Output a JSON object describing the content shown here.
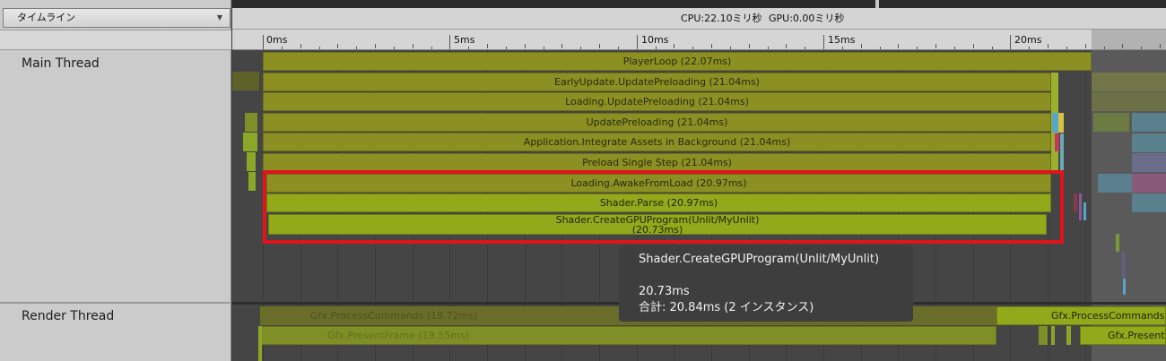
{
  "header": {
    "view_mode": "タイムライン",
    "cpu_label": "CPU:22.10ミリ秒",
    "gpu_label": "GPU:0.00ミリ秒"
  },
  "ruler": {
    "labels": [
      "0ms",
      "5ms",
      "10ms",
      "15ms",
      "20ms"
    ]
  },
  "threads": {
    "main": "Main Thread",
    "render": "Render Thread"
  },
  "main_markers": {
    "player_loop": "PlayerLoop (22.07ms)",
    "early_update": "EarlyUpdate.UpdatePreloading (21.04ms)",
    "loading_update": "Loading.UpdatePreloading (21.04ms)",
    "update_preloading": "UpdatePreloading (21.04ms)",
    "integrate_assets": "Application.Integrate Assets in Background (21.04ms)",
    "preload_single": "Preload Single Step (21.04ms)",
    "awake_from_load": "Loading.AwakeFromLoad (20.97ms)",
    "shader_parse": "Shader.Parse (20.97ms)",
    "create_gpu_line1": "Shader.CreateGPUProgram(Unlit/MyUnlit)",
    "create_gpu_line2": "(20.73ms)"
  },
  "render_markers": {
    "process_commands": "Gfx.ProcessCommands (19.72ms)",
    "present_frame": "Gfx.PresentFrame (19.55ms)",
    "process_commands_next": "Gfx.ProcessCommands",
    "present_next": "Gfx.Present"
  },
  "tooltip": {
    "title": "Shader.CreateGPUProgram(Unlit/MyUnlit)",
    "duration": "20.73ms",
    "total": "合計: 20.84ms (2 インスタンス)"
  },
  "colors": {
    "marker": "#8c9022",
    "marker_selected": "#92a91c",
    "highlight_box": "#e0141a"
  }
}
